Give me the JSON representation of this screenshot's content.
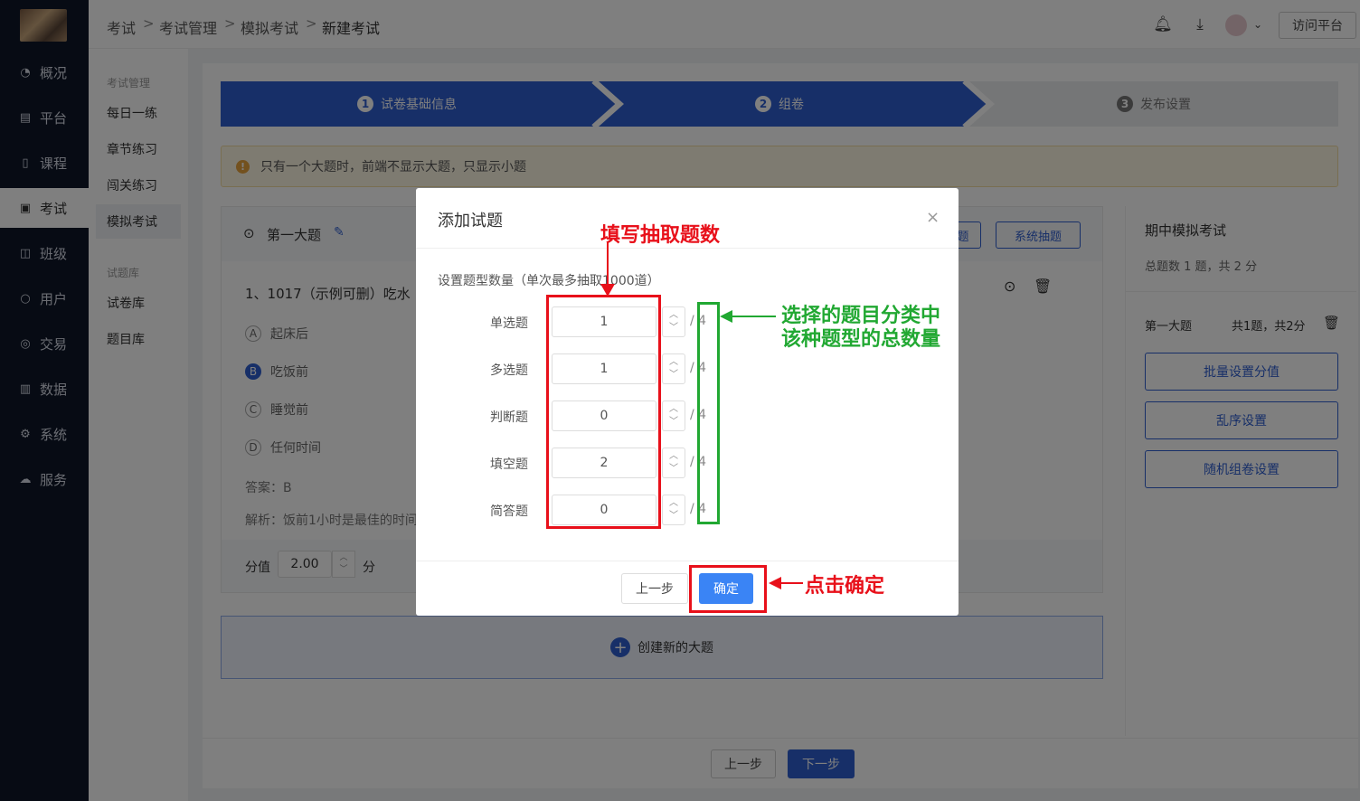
{
  "nav": {
    "items": [
      {
        "label": "概况",
        "icon": "pie-icon"
      },
      {
        "label": "平台",
        "icon": "store-icon"
      },
      {
        "label": "课程",
        "icon": "book-icon"
      },
      {
        "label": "考试",
        "icon": "exam-icon"
      },
      {
        "label": "班级",
        "icon": "class-icon"
      },
      {
        "label": "用户",
        "icon": "user-icon"
      },
      {
        "label": "交易",
        "icon": "trade-icon"
      },
      {
        "label": "数据",
        "icon": "chart-icon"
      },
      {
        "label": "系统",
        "icon": "gear-icon"
      },
      {
        "label": "服务",
        "icon": "service-icon"
      }
    ]
  },
  "subnav": {
    "group1": "考试管理",
    "items1": [
      "每日一练",
      "章节练习",
      "闯关练习",
      "模拟考试"
    ],
    "group2": "试题库",
    "items2": [
      "试卷库",
      "题目库"
    ]
  },
  "breadcrumb": [
    "考试",
    "考试管理",
    "模拟考试",
    "新建考试"
  ],
  "header": {
    "visit": "访问平台"
  },
  "steps": [
    {
      "num": "1",
      "label": "试卷基础信息"
    },
    {
      "num": "2",
      "label": "组卷"
    },
    {
      "num": "3",
      "label": "发布设置"
    }
  ],
  "notice": "只有一个大题时，前端不显示大题，只显示小题",
  "section": {
    "title": "第一大题",
    "btn_partial": "题",
    "btn_system": "系统抽题",
    "question": "1、1017（示例可删）吃水",
    "options": [
      {
        "key": "A",
        "text": "起床后"
      },
      {
        "key": "B",
        "text": "吃饭前"
      },
      {
        "key": "C",
        "text": "睡觉前"
      },
      {
        "key": "D",
        "text": "任何时间"
      }
    ],
    "answer": "答案：B",
    "analysis": "解析：饭前1小时是最佳的时间",
    "score_label": "分值",
    "score_value": "2.00",
    "score_unit": "分"
  },
  "create_label": "创建新的大题",
  "right": {
    "title": "期中模拟考试",
    "summary": "总题数 1 题，共 2 分",
    "section_name": "第一大题",
    "section_stats": "共1题，共2分",
    "buttons": [
      "批量设置分值",
      "乱序设置",
      "随机组卷设置"
    ]
  },
  "footer": {
    "prev": "上一步",
    "next": "下一步"
  },
  "dialog": {
    "title": "添加试题",
    "hint": "设置题型数量（单次最多抽取1000道）",
    "rows": [
      {
        "label": "单选题",
        "value": "1",
        "total": "/ 4"
      },
      {
        "label": "多选题",
        "value": "1",
        "total": "/ 4"
      },
      {
        "label": "判断题",
        "value": "0",
        "total": "/ 4"
      },
      {
        "label": "填空题",
        "value": "2",
        "total": "/ 4"
      },
      {
        "label": "简答题",
        "value": "0",
        "total": "/ 4"
      }
    ],
    "prev": "上一步",
    "confirm": "确定"
  },
  "annotations": {
    "fill_count": "填写抽取题数",
    "category_total_line1": "选择的题目分类中",
    "category_total_line2": "该种题型的总数量",
    "click_confirm": "点击确定"
  },
  "colors": {
    "primary": "#2f5fd0",
    "nav_bg": "#0f1729",
    "annot_red": "#e8101a",
    "annot_green": "#21a832"
  }
}
